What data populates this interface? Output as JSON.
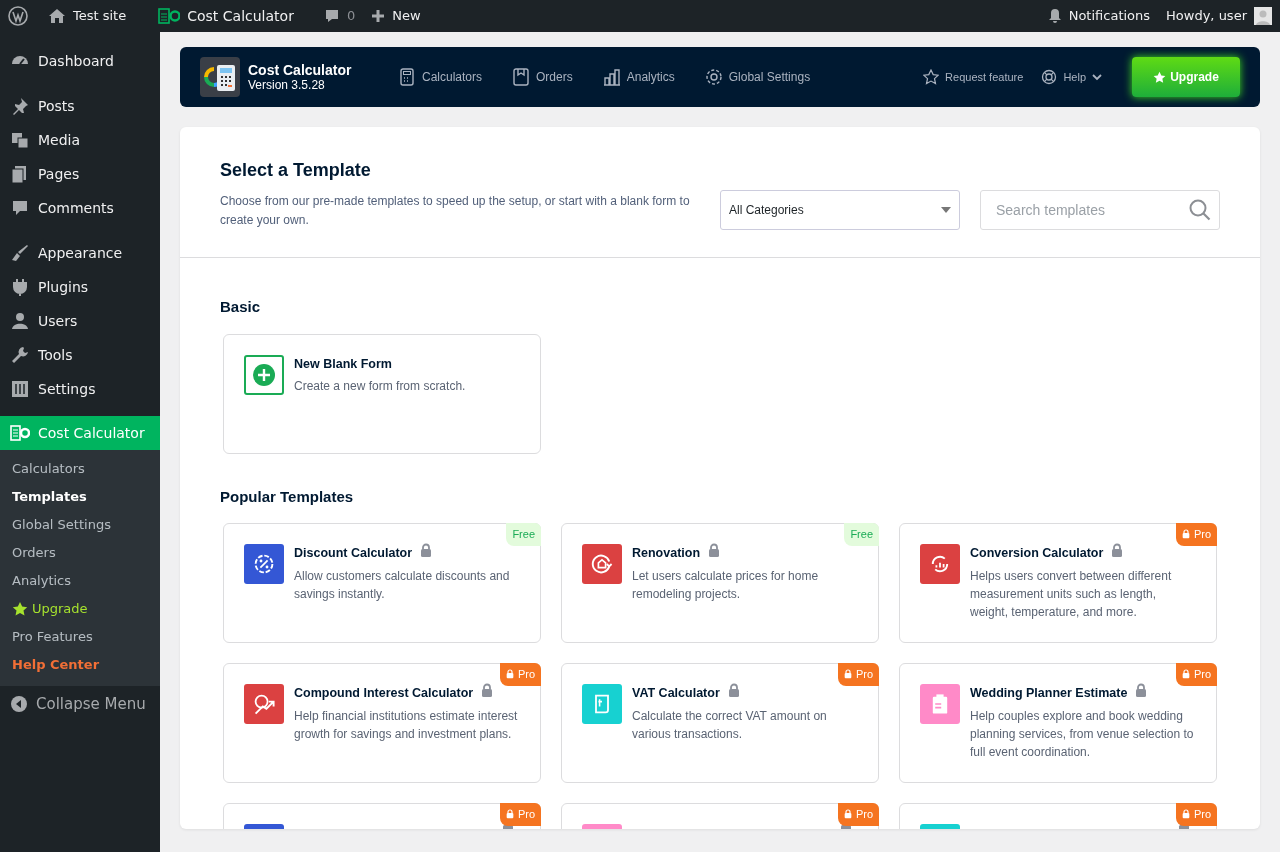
{
  "admin_bar": {
    "site": "Test site",
    "plugin": "Cost Calculator",
    "comments": "0",
    "new": "New",
    "notifications": "Notifications",
    "greeting": "Howdy, user"
  },
  "sidebar": {
    "groups": [
      {
        "items": [
          {
            "label": "Dashboard",
            "selected": false
          }
        ]
      },
      {
        "items": [
          {
            "label": "Posts",
            "selected": false
          },
          {
            "label": "Media",
            "selected": false
          },
          {
            "label": "Pages",
            "selected": false
          },
          {
            "label": "Comments",
            "selected": false
          }
        ]
      },
      {
        "items": [
          {
            "label": "Appearance",
            "selected": false
          },
          {
            "label": "Plugins",
            "selected": false
          },
          {
            "label": "Users",
            "selected": false
          },
          {
            "label": "Tools",
            "selected": false
          },
          {
            "label": "Settings",
            "selected": false
          }
        ]
      },
      {
        "items": [
          {
            "label": "Cost Calculator",
            "selected": true,
            "children": [
              {
                "label": "Calculators",
                "selected": false,
                "kind": "normal"
              },
              {
                "label": "Templates",
                "selected": true,
                "kind": "normal"
              },
              {
                "label": "Global Settings",
                "selected": false,
                "kind": "normal"
              },
              {
                "label": "Orders",
                "selected": false,
                "kind": "normal"
              },
              {
                "label": "Analytics",
                "selected": false,
                "kind": "normal"
              },
              {
                "label": "Upgrade",
                "selected": false,
                "kind": "upgrade"
              },
              {
                "label": "Pro Features",
                "selected": false,
                "kind": "normal"
              },
              {
                "label": "Help Center",
                "selected": false,
                "kind": "help"
              }
            ]
          }
        ]
      }
    ],
    "collapse": "Collapse Menu"
  },
  "plugin_header": {
    "name": "Cost Calculator",
    "version": "Version 3.5.28",
    "nav": [
      {
        "label": "Calculators"
      },
      {
        "label": "Orders"
      },
      {
        "label": "Analytics"
      },
      {
        "label": "Global Settings"
      }
    ],
    "request_feature": "Request feature",
    "help": "Help",
    "upgrade": "Upgrade"
  },
  "page": {
    "title": "Select a Template",
    "description": "Choose from our pre-made templates to speed up the setup, or start with a blank form to create your own.",
    "category_select": "All Categories",
    "search": {
      "placeholder": "Search templates"
    }
  },
  "sections": [
    {
      "title": "Basic",
      "templates": [
        {
          "kind": "blank",
          "title": "New Blank Form",
          "description": "Create a new form from scratch.",
          "color": "#1aab55"
        }
      ]
    },
    {
      "title": "Popular Templates",
      "templates": [
        {
          "kind": "template",
          "title": "Discount Calculator",
          "description": "Allow customers calculate discounts and savings instantly.",
          "color": "#3457d5",
          "badge": {
            "kind": "free",
            "label": "Free"
          }
        },
        {
          "kind": "template",
          "title": "Renovation",
          "description": "Let users calculate prices for home remodeling projects.",
          "color": "#db4141",
          "badge": {
            "kind": "free",
            "label": "Free"
          }
        },
        {
          "kind": "template",
          "title": "Conversion Calculator",
          "description": "Helps users convert between different measurement units such as length, weight, temperature, and more.",
          "color": "#db4141",
          "badge": {
            "kind": "pro",
            "label": "Pro"
          }
        },
        {
          "kind": "template",
          "title": "Compound Interest Calculator",
          "description": "Help financial institutions estimate interest growth for savings and investment plans.",
          "color": "#db4141",
          "badge": {
            "kind": "pro",
            "label": "Pro"
          }
        },
        {
          "kind": "template",
          "title": "VAT Calculator",
          "description": "Calculate the correct VAT amount on various transactions.",
          "color": "#17d1d1",
          "badge": {
            "kind": "pro",
            "label": "Pro"
          }
        },
        {
          "kind": "template",
          "title": "Wedding Planner Estimate",
          "description": "Help couples explore and book wedding planning services, from venue selection to full event coordination.",
          "color": "#ff8ac8",
          "badge": {
            "kind": "pro",
            "label": "Pro"
          }
        },
        {
          "kind": "template",
          "color": "#3457d5",
          "badge": {
            "kind": "pro",
            "label": "Pro"
          }
        },
        {
          "kind": "template",
          "color": "#ff8ac8",
          "badge": {
            "kind": "pro",
            "label": "Pro"
          }
        },
        {
          "kind": "template",
          "color": "#17d1d1",
          "badge": {
            "kind": "pro",
            "label": "Pro"
          }
        }
      ]
    }
  ]
}
